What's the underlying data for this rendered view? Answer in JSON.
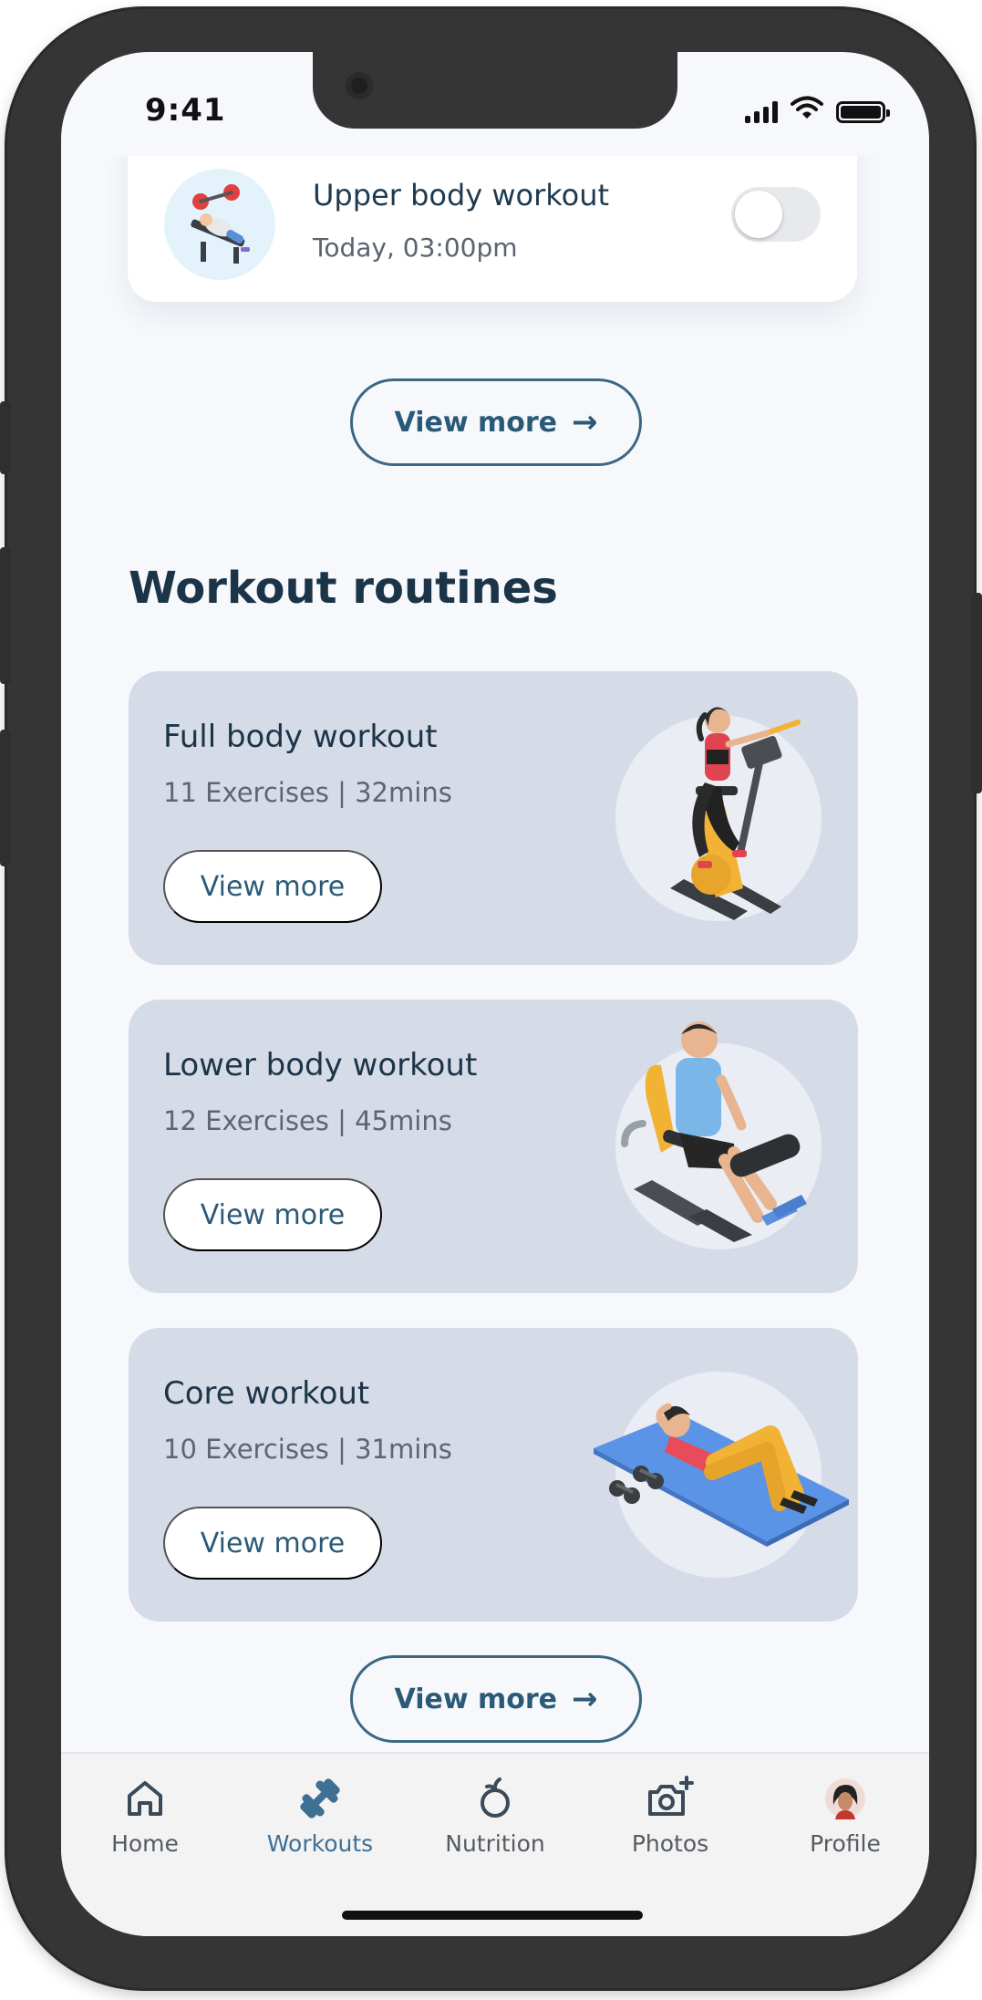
{
  "status_bar": {
    "time": "9:41"
  },
  "top_card": {
    "title": "Upper body workout",
    "subtitle": "Today, 03:00pm",
    "toggle_on": false
  },
  "view_more_top": {
    "label": "View more"
  },
  "routines": {
    "title": "Workout routines",
    "items": [
      {
        "title": "Full body workout",
        "meta": "11 Exercises | 32mins",
        "button": "View more",
        "illustration": "stationary-bike-illustration"
      },
      {
        "title": "Lower body workout",
        "meta": "12 Exercises | 45mins",
        "button": "View more",
        "illustration": "leg-extension-machine-illustration"
      },
      {
        "title": "Core workout",
        "meta": "10 Exercises | 31mins",
        "button": "View more",
        "illustration": "crunches-mat-illustration"
      }
    ],
    "view_more": "View more"
  },
  "bottom_nav": {
    "active": "Workouts",
    "items": [
      {
        "label": "Home",
        "icon": "home-icon"
      },
      {
        "label": "Workouts",
        "icon": "dumbbell-icon"
      },
      {
        "label": "Nutrition",
        "icon": "apple-icon"
      },
      {
        "label": "Photos",
        "icon": "camera-add-icon"
      },
      {
        "label": "Profile",
        "icon": "avatar"
      }
    ]
  },
  "colors": {
    "primary": "#2a5a78",
    "card_bg": "#d6dce7",
    "title": "#1c3448",
    "active_nav": "#3f6f93"
  }
}
